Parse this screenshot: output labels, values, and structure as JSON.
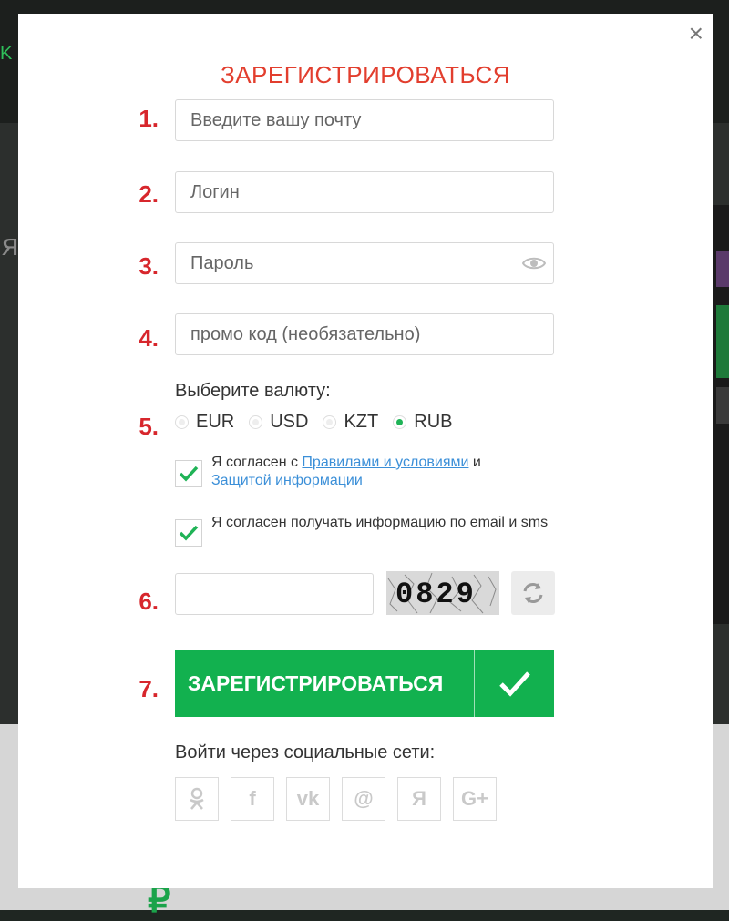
{
  "modal": {
    "title": "ЗАРЕГИСТРИРОВАТЬСЯ",
    "close": "×"
  },
  "steps": [
    "1.",
    "2.",
    "3.",
    "4.",
    "5.",
    "6.",
    "7."
  ],
  "form": {
    "email_placeholder": "Введите вашу почту",
    "login_placeholder": "Логин",
    "password_placeholder": "Пароль",
    "promo_placeholder": "промо код (необязательно)"
  },
  "currency": {
    "label": "Выберите валюту:",
    "options": [
      "EUR",
      "USD",
      "KZT",
      "RUB"
    ],
    "selected": "RUB"
  },
  "terms": {
    "prefix": "Я согласен с ",
    "link1": "Правилами и условиями",
    "middle": " и ",
    "link2": "Защитой информации",
    "checked": true
  },
  "newsletter": {
    "text": "Я согласен получать информацию по email и sms",
    "checked": true
  },
  "captcha": {
    "code": "0829"
  },
  "submit": {
    "label": "ЗАРЕГИСТРИРОВАТЬСЯ"
  },
  "social": {
    "label": "Войти через социальные сети:",
    "icons": [
      {
        "name": "odnoklassniki-icon",
        "glyph": "ok"
      },
      {
        "name": "facebook-icon",
        "glyph": "f"
      },
      {
        "name": "vk-icon",
        "glyph": "vk"
      },
      {
        "name": "mailru-icon",
        "glyph": "@"
      },
      {
        "name": "yandex-icon",
        "glyph": "Я"
      },
      {
        "name": "google-plus-icon",
        "glyph": "G+"
      }
    ]
  },
  "colors": {
    "accent_green": "#12b14f",
    "title_red": "#e23e2e",
    "step_red": "#d7262c",
    "link_blue": "#3b8fd8"
  }
}
